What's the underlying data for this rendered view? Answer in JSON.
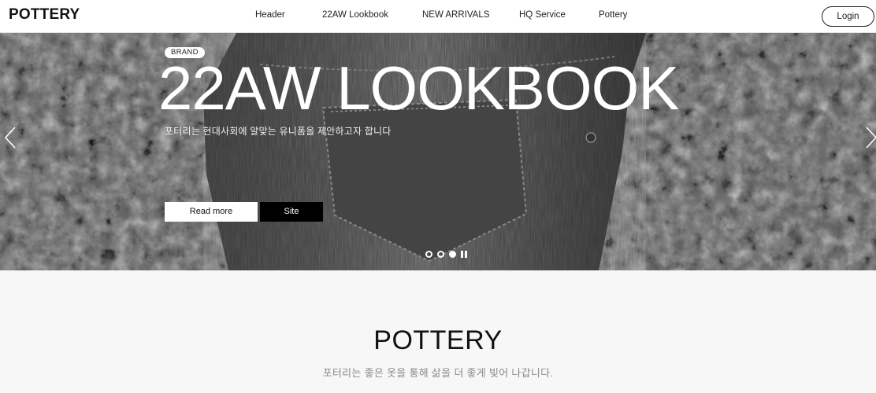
{
  "header": {
    "logo": "POTTERY",
    "nav": [
      "Header",
      "22AW Lookbook",
      "NEW ARRIVALS",
      "HQ Service",
      "Pottery"
    ],
    "login_label": "Login"
  },
  "hero": {
    "tag": "BRAND",
    "title": "22AW LOOKBOOK",
    "subtitle": "포터리는 현대사회에 알맞는 유니폼을 제안하고자 합니다",
    "read_more_label": "Read more",
    "site_label": "Site",
    "slide_count": 3,
    "active_slide": 3
  },
  "intro": {
    "title": "POTTERY",
    "subtitle": "포터리는 좋은 옷을 통해 삶을 더 좋게 빚어 나갑니다."
  },
  "colors": {
    "header_bg": "#ffffff",
    "hero_overlay": "#4a4a4a",
    "accent_dark": "#000000",
    "intro_bg": "#f7f7f7",
    "intro_sub": "#8a8a8a"
  },
  "icons": {
    "prev": "chevron-left-icon",
    "next": "chevron-right-icon",
    "pause": "pause-icon"
  }
}
